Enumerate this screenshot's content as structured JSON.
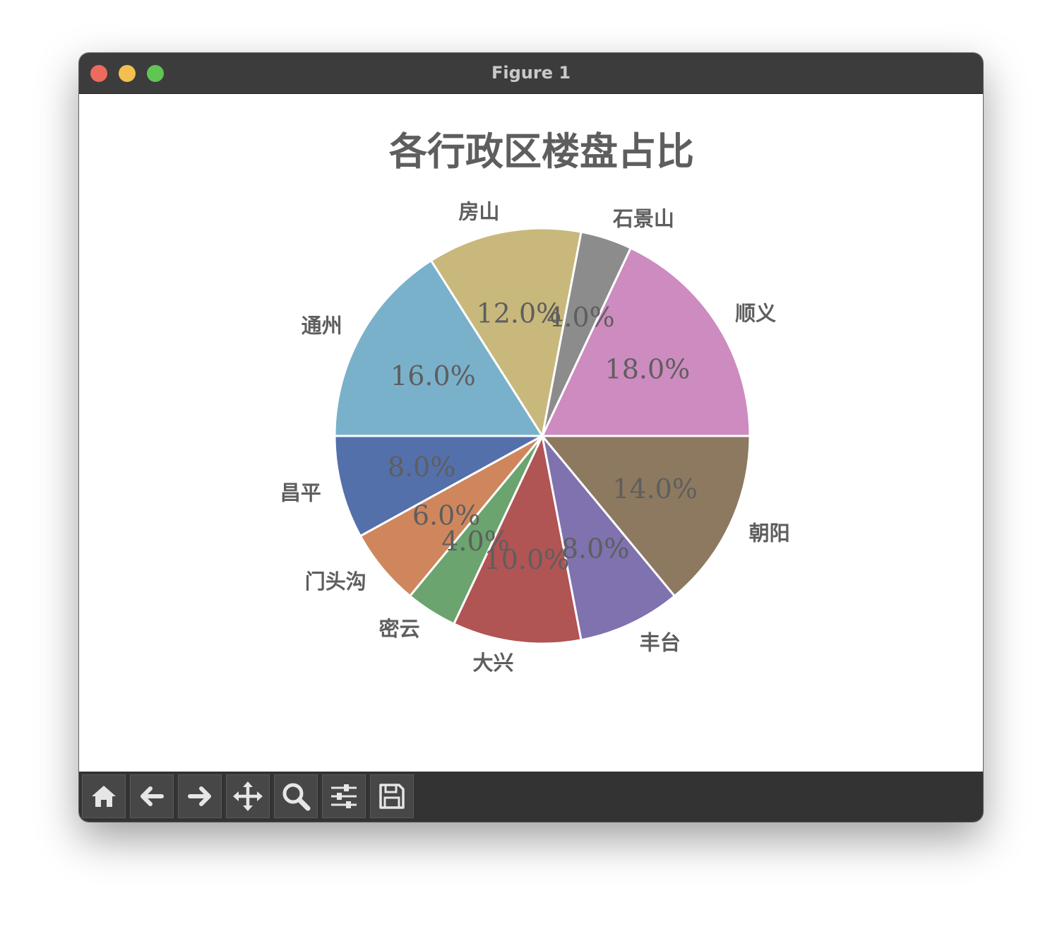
{
  "window": {
    "title": "Figure 1"
  },
  "toolbar": {
    "buttons": [
      {
        "name": "home-button",
        "icon": "home-icon"
      },
      {
        "name": "back-button",
        "icon": "arrow-left-icon"
      },
      {
        "name": "forward-button",
        "icon": "arrow-right-icon"
      },
      {
        "name": "pan-button",
        "icon": "move-icon"
      },
      {
        "name": "zoom-button",
        "icon": "magnifier-icon"
      },
      {
        "name": "configure-subplots-button",
        "icon": "sliders-icon"
      },
      {
        "name": "save-button",
        "icon": "floppy-disk-icon"
      }
    ]
  },
  "chart_data": {
    "type": "pie",
    "title": "各行政区楼盘占比",
    "start_angle_deg": 0,
    "direction": "counterclockwise",
    "value_format": "percent_one_decimal",
    "slices": [
      {
        "label": "顺义",
        "value": 18.0,
        "color": "#cd8bc0"
      },
      {
        "label": "石景山",
        "value": 4.0,
        "color": "#8c8c8c"
      },
      {
        "label": "房山",
        "value": 12.0,
        "color": "#c8b87b"
      },
      {
        "label": "通州",
        "value": 16.0,
        "color": "#7ab1ca"
      },
      {
        "label": "昌平",
        "value": 8.0,
        "color": "#5470ab"
      },
      {
        "label": "门头沟",
        "value": 6.0,
        "color": "#d0865c"
      },
      {
        "label": "密云",
        "value": 4.0,
        "color": "#6ba46e"
      },
      {
        "label": "大兴",
        "value": 10.0,
        "color": "#b15454"
      },
      {
        "label": "丰台",
        "value": 8.0,
        "color": "#7f72ae"
      },
      {
        "label": "朝阳",
        "value": 14.0,
        "color": "#8c7960"
      }
    ],
    "text_color": "#5e5e5e"
  }
}
